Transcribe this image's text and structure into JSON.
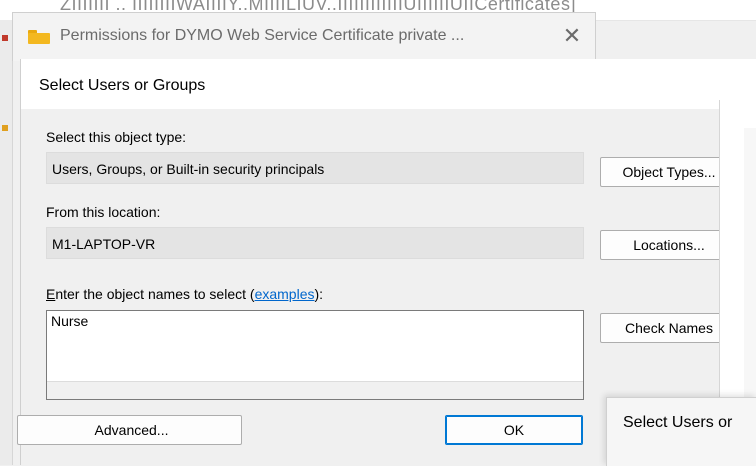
{
  "background": {
    "text": "ZIIIIIII .. IIIIIIIIWAIIIIY..MIIIILIUV..IIIIIIIIIIIIUIIIIIIUIICertificates]"
  },
  "permissions_window": {
    "title": "Permissions for DYMO Web Service Certificate private ...",
    "close_glyph": "✕",
    "icon": "folder-icon"
  },
  "dialog": {
    "title": "Select Users or Groups",
    "object_type_label": "Select this object type:",
    "object_type_value": "Users, Groups, or Built-in security principals",
    "object_types_button": "Object Types...",
    "location_label": "From this location:",
    "location_value": "M1-LAPTOP-VR",
    "locations_button": "Locations...",
    "names_label_accel": "E",
    "names_label_rest": "nter the object names to select (",
    "names_label_link": "examples",
    "names_label_end": "):",
    "names_value": "Nurse",
    "check_names_button": "Check Names",
    "advanced_button": "Advanced...",
    "ok_button": "OK"
  },
  "popup": {
    "title": "Select Users or"
  },
  "colors": {
    "accent": "#0078d4",
    "link": "#0066cc",
    "folder": "#f3b820"
  }
}
